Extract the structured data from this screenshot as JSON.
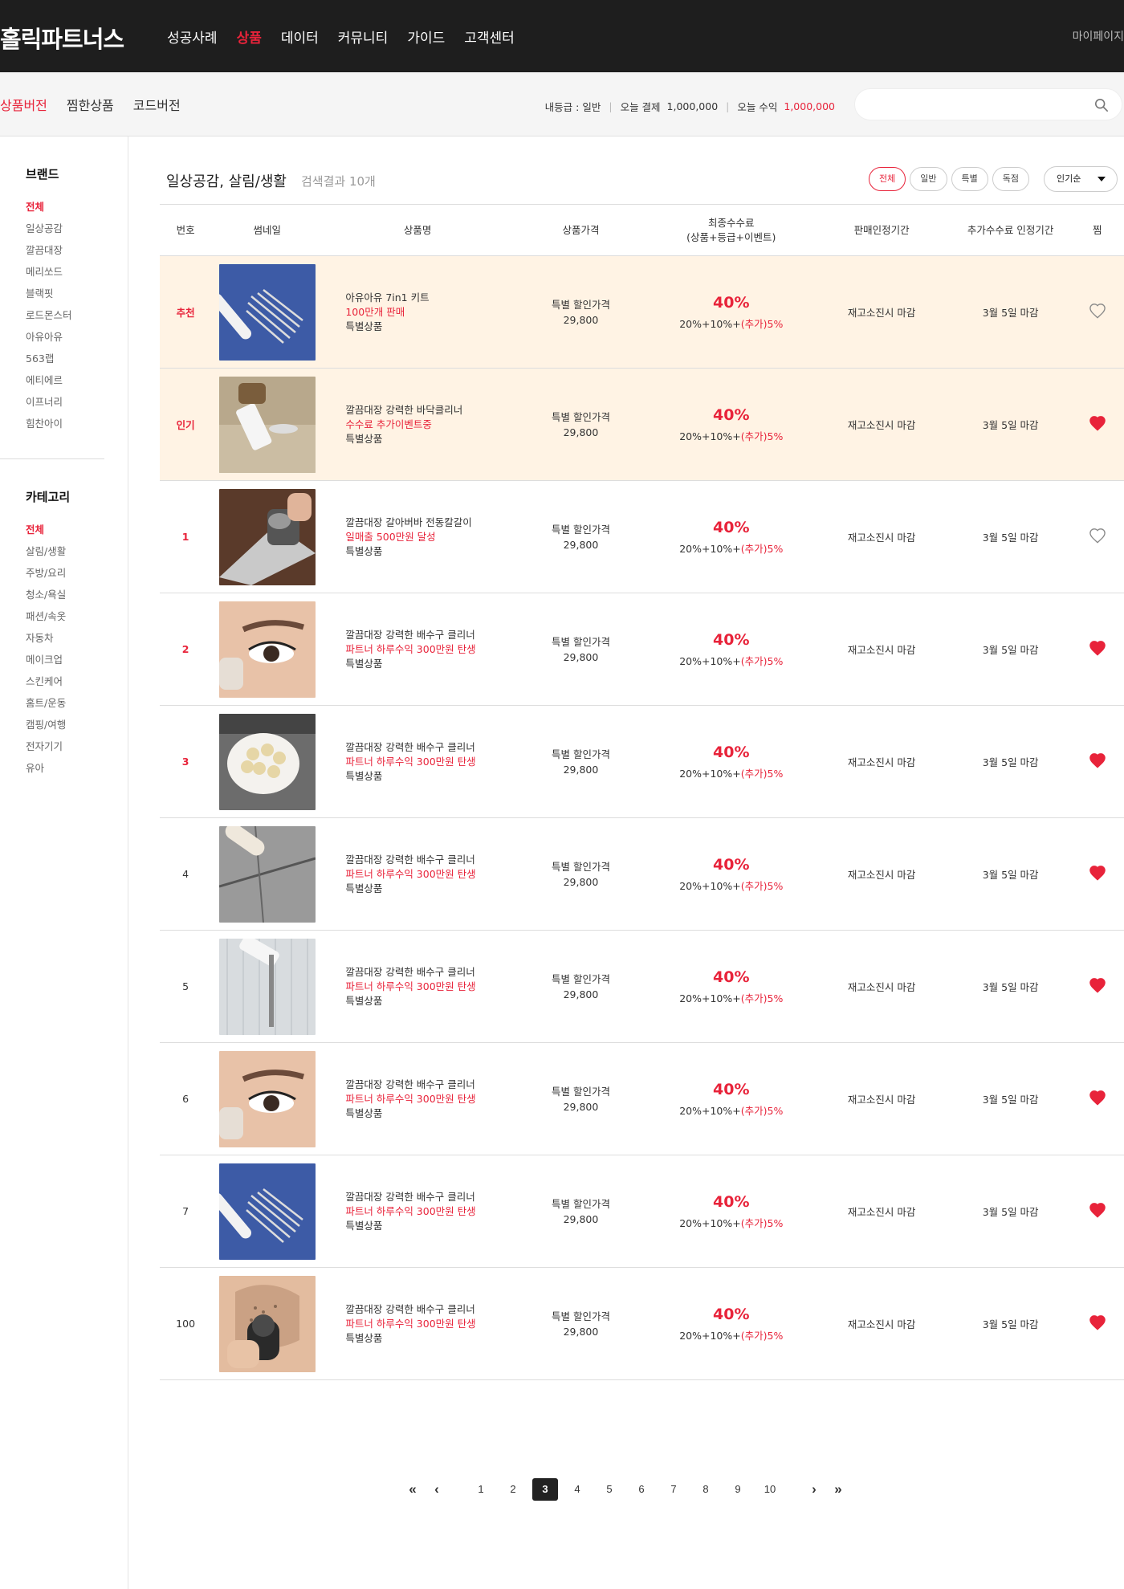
{
  "header": {
    "logo": "홀릭파트너스",
    "nav": [
      {
        "label": "성공사례",
        "active": false
      },
      {
        "label": "상품",
        "active": true
      },
      {
        "label": "데이터",
        "active": false
      },
      {
        "label": "커뮤니티",
        "active": false
      },
      {
        "label": "가이드",
        "active": false
      },
      {
        "label": "고객센터",
        "active": false
      }
    ],
    "mypage": "마이페이지"
  },
  "subbar": {
    "tabs": [
      {
        "label": "상품버전",
        "active": true
      },
      {
        "label": "찜한상품",
        "active": false
      },
      {
        "label": "코드버전",
        "active": false
      }
    ],
    "grade_label": "내등급 : 일반",
    "payment_label": "오늘 결제",
    "payment_value": "1,000,000",
    "income_label": "오늘 수익",
    "income_value": "1,000,000",
    "search": {
      "value": "",
      "placeholder": ""
    }
  },
  "sidebar": {
    "brand_title": "브랜드",
    "brands": [
      "전체",
      "일상공감",
      "깔끔대장",
      "메리쏘드",
      "블랙핏",
      "로드몬스터",
      "아유아유",
      "563랩",
      "에티에르",
      "이프너리",
      "힘찬아이"
    ],
    "category_title": "카테고리",
    "categories": [
      "전체",
      "살림/생활",
      "주방/요리",
      "청소/욕실",
      "패션/속옷",
      "자동차",
      "메이크업",
      "스킨케어",
      "홈트/운동",
      "캠핑/여행",
      "전자기기",
      "유아"
    ]
  },
  "main": {
    "heading": "일상공감, 살림/생활",
    "result_count": "검색결과 10개",
    "filters": [
      {
        "label": "전체",
        "active": true
      },
      {
        "label": "일반",
        "active": false
      },
      {
        "label": "특별",
        "active": false
      },
      {
        "label": "독점",
        "active": false
      }
    ],
    "sort": "인기순",
    "columns": {
      "no": "번호",
      "thumb": "썸네일",
      "name": "상품명",
      "price": "상품가격",
      "commission_line1": "최종수수료",
      "commission_line2": "(상품+등급+이벤트)",
      "sale_period": "판매인정기간",
      "extra_period": "추가수수료 인정기간",
      "like": "찜"
    },
    "rows": [
      {
        "rank": "추천",
        "rank_red": true,
        "highlight": true,
        "thumb": "tweezers",
        "name": "아유아유 7in1 키트",
        "promo": "100만개 판매",
        "tag": "특별상품",
        "price_label": "특별 할인가격",
        "price": "29,800",
        "pct": "40%",
        "detail": "20%+10%+",
        "extra": "(추가)5%",
        "sale_period": "재고소진시 마감",
        "extra_period": "3월 5일 마감",
        "liked": false
      },
      {
        "rank": "인기",
        "rank_red": true,
        "highlight": true,
        "thumb": "floor",
        "name": "깔끔대장 강력한 바닥클리너",
        "promo": "수수료 추가이벤트중",
        "tag": "특별상품",
        "price_label": "특별 할인가격",
        "price": "29,800",
        "pct": "40%",
        "detail": "20%+10%+",
        "extra": "(추가)5%",
        "sale_period": "재고소진시 마감",
        "extra_period": "3월 5일 마감",
        "liked": true
      },
      {
        "rank": "1",
        "rank_red": true,
        "highlight": false,
        "thumb": "sharpener",
        "name": "깔끔대장 갈아버바 전동칼갈이",
        "promo": "일매출 500만원 달성",
        "tag": "특별상품",
        "price_label": "특별 할인가격",
        "price": "29,800",
        "pct": "40%",
        "detail": "20%+10%+",
        "extra": "(추가)5%",
        "sale_period": "재고소진시 마감",
        "extra_period": "3월 5일 마감",
        "liked": false
      },
      {
        "rank": "2",
        "rank_red": true,
        "highlight": false,
        "thumb": "eye",
        "name": "깔끔대장 강력한 배수구 클리너",
        "promo": "파트너 하루수익 300만원 탄생",
        "tag": "특별상품",
        "price_label": "특별 할인가격",
        "price": "29,800",
        "pct": "40%",
        "detail": "20%+10%+",
        "extra": "(추가)5%",
        "sale_period": "재고소진시 마감",
        "extra_period": "3월 5일 마감",
        "liked": true
      },
      {
        "rank": "3",
        "rank_red": true,
        "highlight": false,
        "thumb": "steamer",
        "name": "깔끔대장 강력한 배수구 클리너",
        "promo": "파트너 하루수익 300만원 탄생",
        "tag": "특별상품",
        "price_label": "특별 할인가격",
        "price": "29,800",
        "pct": "40%",
        "detail": "20%+10%+",
        "extra": "(추가)5%",
        "sale_period": "재고소진시 마감",
        "extra_period": "3월 5일 마감",
        "liked": true
      },
      {
        "rank": "4",
        "rank_red": false,
        "highlight": false,
        "thumb": "grout",
        "name": "깔끔대장 강력한 배수구 클리너",
        "promo": "파트너 하루수익 300만원 탄생",
        "tag": "특별상품",
        "price_label": "특별 할인가격",
        "price": "29,800",
        "pct": "40%",
        "detail": "20%+10%+",
        "extra": "(추가)5%",
        "sale_period": "재고소진시 마감",
        "extra_period": "3월 5일 마감",
        "liked": true
      },
      {
        "rank": "5",
        "rank_red": false,
        "highlight": false,
        "thumb": "squeegee",
        "name": "깔끔대장 강력한 배수구 클리너",
        "promo": "파트너 하루수익 300만원 탄생",
        "tag": "특별상품",
        "price_label": "특별 할인가격",
        "price": "29,800",
        "pct": "40%",
        "detail": "20%+10%+",
        "extra": "(추가)5%",
        "sale_period": "재고소진시 마감",
        "extra_period": "3월 5일 마감",
        "liked": true
      },
      {
        "rank": "6",
        "rank_red": false,
        "highlight": false,
        "thumb": "eye",
        "name": "깔끔대장 강력한 배수구 클리너",
        "promo": "파트너 하루수익 300만원 탄생",
        "tag": "특별상품",
        "price_label": "특별 할인가격",
        "price": "29,800",
        "pct": "40%",
        "detail": "20%+10%+",
        "extra": "(추가)5%",
        "sale_period": "재고소진시 마감",
        "extra_period": "3월 5일 마감",
        "liked": true
      },
      {
        "rank": "7",
        "rank_red": false,
        "highlight": false,
        "thumb": "tweezers",
        "name": "깔끔대장 강력한 배수구 클리너",
        "promo": "파트너 하루수익 300만원 탄생",
        "tag": "특별상품",
        "price_label": "특별 할인가격",
        "price": "29,800",
        "pct": "40%",
        "detail": "20%+10%+",
        "extra": "(추가)5%",
        "sale_period": "재고소진시 마감",
        "extra_period": "3월 5일 마감",
        "liked": true
      },
      {
        "rank": "100",
        "rank_red": false,
        "highlight": false,
        "thumb": "shaver",
        "name": "깔끔대장 강력한 배수구 클리너",
        "promo": "파트너 하루수익 300만원 탄생",
        "tag": "특별상품",
        "price_label": "특별 할인가격",
        "price": "29,800",
        "pct": "40%",
        "detail": "20%+10%+",
        "extra": "(추가)5%",
        "sale_period": "재고소진시 마감",
        "extra_period": "3월 5일 마감",
        "liked": true
      }
    ]
  },
  "pagination": {
    "pages": [
      "1",
      "2",
      "3",
      "4",
      "5",
      "6",
      "7",
      "8",
      "9",
      "10"
    ],
    "current": "3",
    "first_icon": "double-chevron-left-icon",
    "prev_icon": "chevron-left-icon",
    "next_icon": "chevron-right-icon",
    "last_icon": "double-chevron-right-icon"
  },
  "colors": {
    "accent": "#e8233a",
    "header_bg": "#1e1e1e",
    "highlight_row": "#fff3e4"
  }
}
